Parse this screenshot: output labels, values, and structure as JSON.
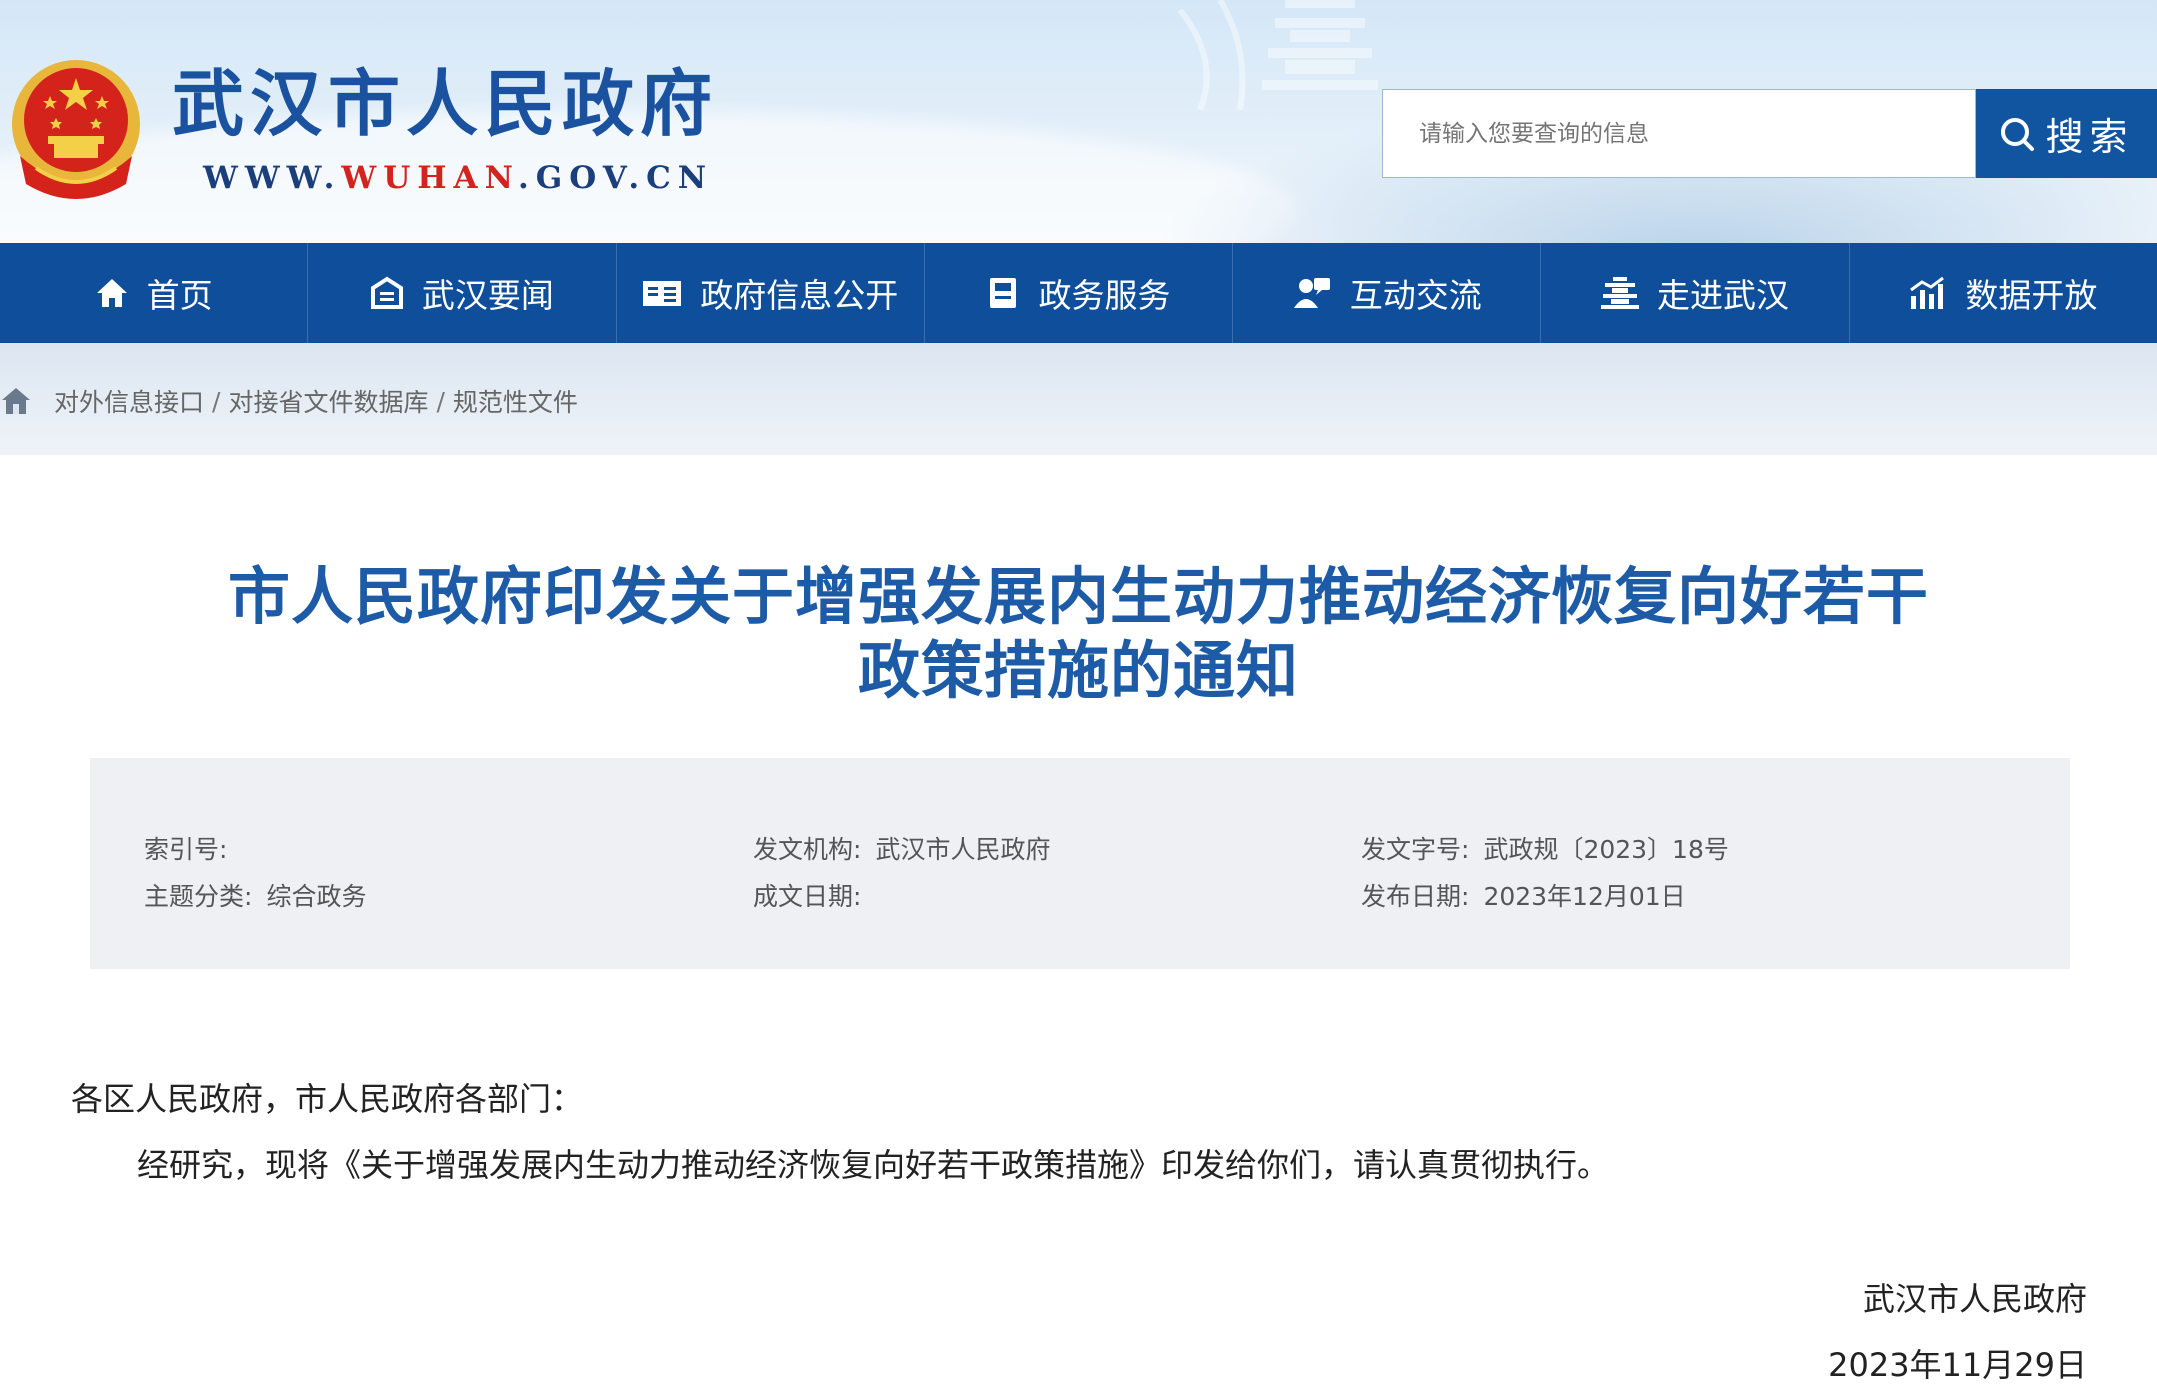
{
  "header": {
    "site_title": "武汉市人民政府",
    "url_prefix": "WWW.",
    "url_highlight": "WUHAN",
    "url_suffix": ".GOV.CN",
    "search_placeholder": "请输入您要查询的信息",
    "search_button": "搜索",
    "brand_color": "#1154a0"
  },
  "nav": {
    "items": [
      {
        "label": "首页",
        "icon": "home-icon"
      },
      {
        "label": "武汉要闻",
        "icon": "news-icon"
      },
      {
        "label": "政府信息公开",
        "icon": "info-disclosure-icon"
      },
      {
        "label": "政务服务",
        "icon": "service-icon"
      },
      {
        "label": "互动交流",
        "icon": "interaction-icon"
      },
      {
        "label": "走进武汉",
        "icon": "tower-icon"
      },
      {
        "label": "数据开放",
        "icon": "data-chart-icon"
      }
    ]
  },
  "breadcrumb": {
    "items": [
      "对外信息接口",
      "对接省文件数据库",
      "规范性文件"
    ],
    "separator": "/"
  },
  "document": {
    "title_line1": "市人民政府印发关于增强发展内生动力推动经济恢复向好若干",
    "title_line2": "政策措施的通知",
    "meta": {
      "index_label": "索引号:",
      "index_value": "",
      "issuer_label": "发文机构:",
      "issuer_value": "武汉市人民政府",
      "docno_label": "发文字号:",
      "docno_value": "武政规〔2023〕18号",
      "topic_label": "主题分类:",
      "topic_value": "综合政务",
      "written_label": "成文日期:",
      "written_value": "",
      "publish_label": "发布日期:",
      "publish_value": "2023年12月01日"
    },
    "salutation": "各区人民政府，市人民政府各部门：",
    "body": "经研究，现将《关于增强发展内生动力推动经济恢复向好若干政策措施》印发给你们，请认真贯彻执行。",
    "signature_org": "武汉市人民政府",
    "signature_date": "2023年11月29日"
  }
}
